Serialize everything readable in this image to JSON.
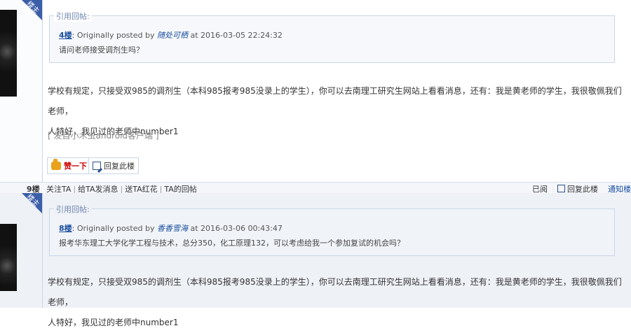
{
  "colors": {
    "accent": "#3b5ea8",
    "link": "#1a4fa0",
    "like": "#cc0000",
    "border": "#c9d6e6"
  },
  "posts": [
    {
      "badge": "楼主",
      "quote": {
        "legend": "引用回帖:",
        "floor": "4楼",
        "posted_by": ": Originally posted by",
        "author": "随处可栖",
        "at": "at 2016-03-05 22:24:32",
        "body": "请问老师接受调剂生吗？"
      },
      "content_line1": "学校有规定，只接受双985的调剂生（本科985报考985没录上的学生），你可以去南理工研究生网站上看看消息，还有：我是黄老师的学生，我很敬佩我们老师，",
      "content_line2": "人特好，我见过的老师中number1",
      "source": "[ 发自小木虫android客户端 ]",
      "like_label": "赞一下",
      "reply_label": "回复此楼"
    },
    {
      "badge": "楼主",
      "quote": {
        "legend": "引用回帖:",
        "floor": "8楼",
        "posted_by": ": Originally posted by",
        "author": "香香雪海",
        "at": "at 2016-03-06 00:43:47",
        "body": "报考华东理工大学化学工程与技术，总分350，化工原理132，可以考虑给我一个参加复试的机会吗？"
      },
      "content_line1": "学校有规定，只接受双985的调剂生（本科985报考985没录上的学生），你可以去南理工研究生网站上看看消息，还有：我是黄老师的学生，我很敬佩我们老师，",
      "content_line2": "人特好，我见过的老师中number1"
    }
  ],
  "action_bar": {
    "floor": "9楼",
    "follow": "关注TA",
    "message": "给TA发消息",
    "flower": "送TA红花",
    "replies": "TA的回帖",
    "read": "已阅",
    "reply": "回复此楼",
    "notify": "通知楼"
  }
}
